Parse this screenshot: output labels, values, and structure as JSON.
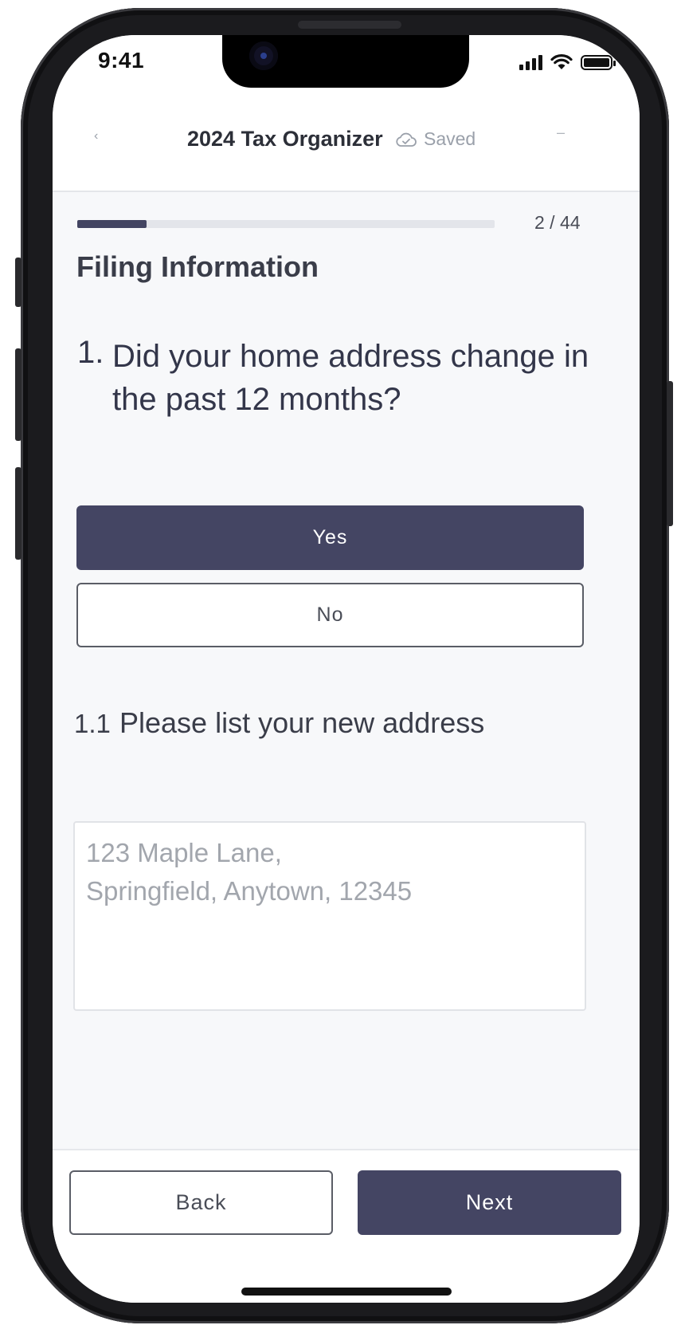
{
  "status_bar": {
    "time": "9:41"
  },
  "header": {
    "back_icon": "chevron-left-icon",
    "title": "2024 Tax Organizer",
    "saved_icon": "cloud-check-icon",
    "saved_label": "Saved",
    "more_icon": "dash-icon"
  },
  "progress": {
    "label": "2 / 44",
    "current": 2,
    "total": 44
  },
  "section": {
    "title": "Filing Information"
  },
  "question": {
    "number": "1.",
    "text": "Did your home address change in the past 12 months?",
    "options": [
      {
        "label": "Yes",
        "selected": true
      },
      {
        "label": "No",
        "selected": false
      }
    ]
  },
  "subquestion": {
    "number": "1.1",
    "text": "Please list your new address",
    "value": "123 Maple Lane,\nSpringfield, Anytown, 12345"
  },
  "footer": {
    "back_label": "Back",
    "next_label": "Next"
  },
  "colors": {
    "accent": "#444563",
    "background": "#f7f8fa",
    "muted": "#9aa0aa"
  }
}
